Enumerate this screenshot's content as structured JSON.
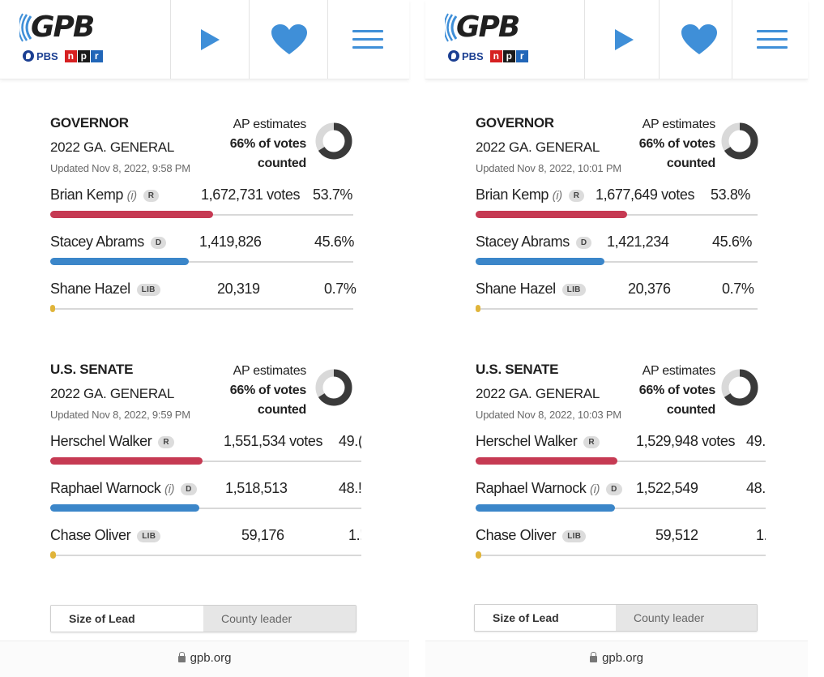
{
  "panels": [
    {
      "header": {
        "logo": "GPB",
        "pbs": "PBS",
        "npr": [
          "n",
          "p",
          "r"
        ]
      },
      "races": [
        {
          "title": "GOVERNOR",
          "subtitle": "2022 GA. GENERAL",
          "updated": "Updated Nov 8, 2022, 9:58 PM",
          "ap_line1": "AP estimates",
          "ap_line2": "66% of votes",
          "ap_line3": "counted",
          "pct_counted": 0.66,
          "candidates": [
            {
              "name": "Brian Kemp",
              "incumbent": "(i)",
              "party": "R",
              "votes": "1,672,731 votes",
              "pct": "53.7%",
              "share": 0.537
            },
            {
              "name": "Stacey Abrams",
              "incumbent": "",
              "party": "D",
              "votes": "1,419,826",
              "pct": "45.6%",
              "share": 0.456
            },
            {
              "name": "Shane Hazel",
              "incumbent": "",
              "party": "LIB",
              "votes": "20,319",
              "pct": "0.7%",
              "share": 0.007
            }
          ]
        },
        {
          "title": "U.S. SENATE",
          "subtitle": "2022 GA. GENERAL",
          "updated": "Updated Nov 8, 2022, 9:59 PM",
          "ap_line1": "AP estimates",
          "ap_line2": "66% of votes",
          "ap_line3": "counted",
          "pct_counted": 0.66,
          "candidates": [
            {
              "name": "Herschel Walker",
              "incumbent": "",
              "party": "R",
              "votes": "1,551,534 votes",
              "pct": "49.(",
              "share": 0.49
            },
            {
              "name": "Raphael Warnock",
              "incumbent": "(i)",
              "party": "D",
              "votes": "1,518,513",
              "pct": "48.!",
              "share": 0.48
            },
            {
              "name": "Chase Oliver",
              "incumbent": "",
              "party": "LIB",
              "votes": "59,176",
              "pct": "1.!",
              "share": 0.019
            }
          ]
        }
      ],
      "toggle": {
        "active": "Size of Lead",
        "inactive": "County leader"
      },
      "url": "gpb.org"
    },
    {
      "header": {
        "logo": "GPB",
        "pbs": "PBS",
        "npr": [
          "n",
          "p",
          "r"
        ]
      },
      "races": [
        {
          "title": "GOVERNOR",
          "subtitle": "2022 GA. GENERAL",
          "updated": "Updated Nov 8, 2022, 10:01 PM",
          "ap_line1": "AP estimates",
          "ap_line2": "66% of votes",
          "ap_line3": "counted",
          "pct_counted": 0.66,
          "candidates": [
            {
              "name": "Brian Kemp",
              "incumbent": "(i)",
              "party": "R",
              "votes": "1,677,649 votes",
              "pct": "53.8%",
              "share": 0.538
            },
            {
              "name": "Stacey Abrams",
              "incumbent": "",
              "party": "D",
              "votes": "1,421,234",
              "pct": "45.6%",
              "share": 0.456
            },
            {
              "name": "Shane Hazel",
              "incumbent": "",
              "party": "LIB",
              "votes": "20,376",
              "pct": "0.7%",
              "share": 0.007
            }
          ]
        },
        {
          "title": "U.S. SENATE",
          "subtitle": "2022 GA. GENERAL",
          "updated": "Updated Nov 8, 2022, 10:03 PM",
          "ap_line1": "AP estimates",
          "ap_line2": "66% of votes",
          "ap_line3": "counted",
          "pct_counted": 0.66,
          "candidates": [
            {
              "name": "Herschel Walker",
              "incumbent": "",
              "party": "R",
              "votes": "1,529,948 votes",
              "pct": "49.",
              "share": 0.49
            },
            {
              "name": "Raphael Warnock",
              "incumbent": "(i)",
              "party": "D",
              "votes": "1,522,549",
              "pct": "48.",
              "share": 0.48
            },
            {
              "name": "Chase Oliver",
              "incumbent": "",
              "party": "LIB",
              "votes": "59,512",
              "pct": "1.",
              "share": 0.019
            }
          ]
        }
      ],
      "toggle": {
        "active": "Size of Lead",
        "inactive": "County leader"
      },
      "url": "gpb.org"
    }
  ],
  "colors": {
    "republican": "#c63a53",
    "democrat": "#3b86c9",
    "libertarian": "#e0b43a",
    "accent": "#3f8fd8"
  }
}
